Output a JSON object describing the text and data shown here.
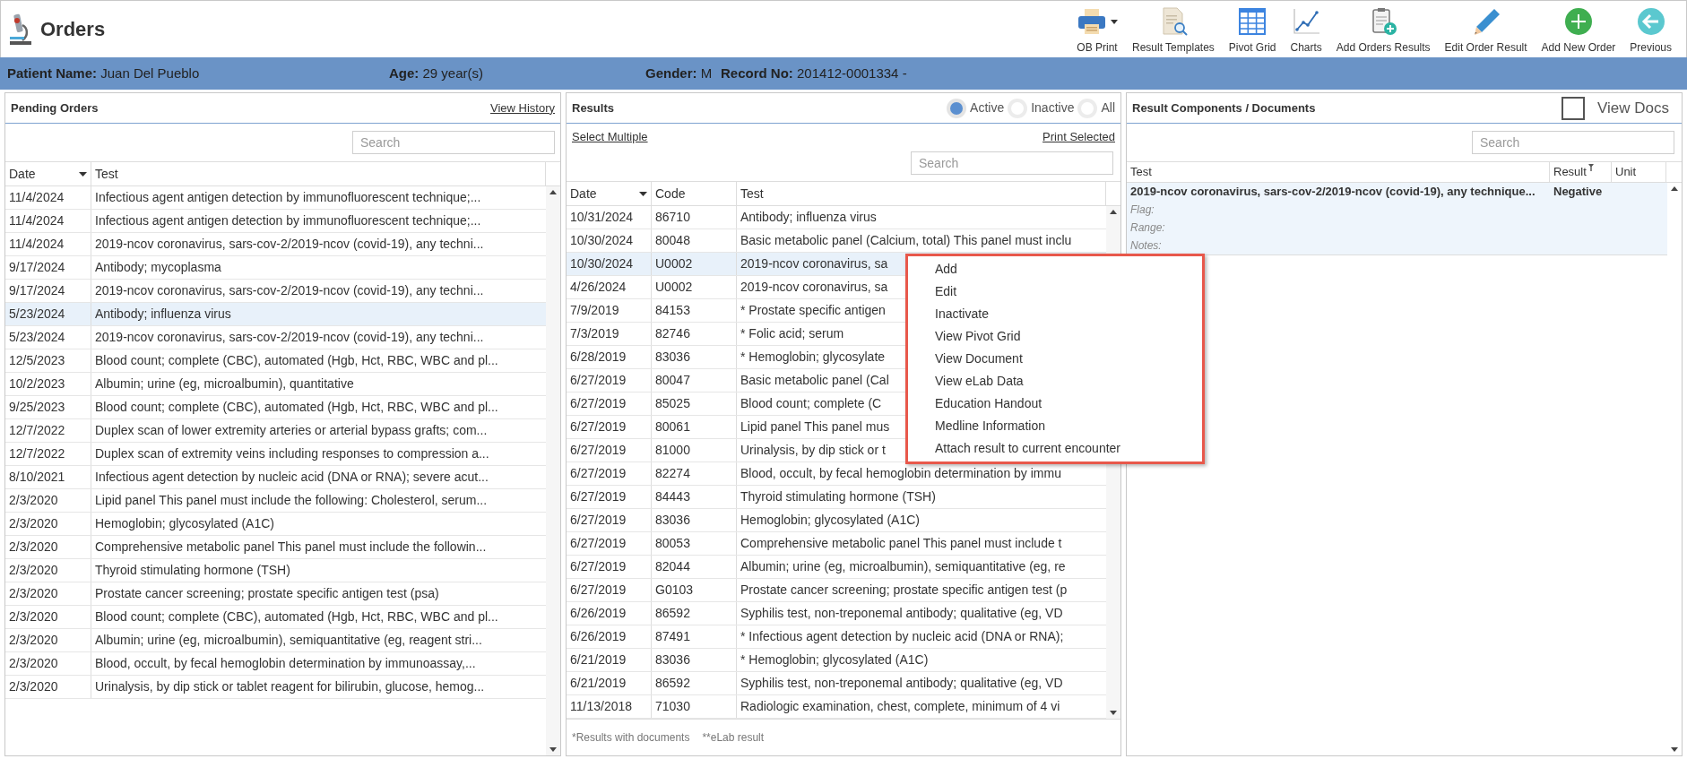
{
  "app": {
    "title": "Orders"
  },
  "toolbar": [
    {
      "label": "OB Print",
      "kind": "printer",
      "dropdown": true
    },
    {
      "label": "Result Templates",
      "kind": "templates",
      "dropdown": false
    },
    {
      "label": "Pivot Grid",
      "kind": "grid",
      "dropdown": false
    },
    {
      "label": "Charts",
      "kind": "chart",
      "dropdown": false
    },
    {
      "label": "Add Orders Results",
      "kind": "clipboard",
      "dropdown": false
    },
    {
      "label": "Edit Order Result",
      "kind": "pencil",
      "dropdown": false
    },
    {
      "label": "Add New Order",
      "kind": "add",
      "dropdown": false
    },
    {
      "label": "Previous",
      "kind": "back",
      "dropdown": false
    }
  ],
  "patient": [
    {
      "label": "Patient Name:",
      "value": "Juan Del Pueblo"
    },
    {
      "label": "Age:",
      "value": "29 year(s)"
    },
    {
      "label": "Gender:",
      "value": "M"
    },
    {
      "label": "Record No:",
      "value": "201412-0001334 -"
    }
  ],
  "pending_orders": {
    "title": "Pending Orders",
    "link": "View History",
    "search": {
      "placeholder": "Search"
    },
    "columns": [
      "Date",
      "Test"
    ],
    "rows": [
      {
        "date": "11/4/2024",
        "test": "Infectious agent antigen detection by immunofluorescent technique;...",
        "selected": false
      },
      {
        "date": "11/4/2024",
        "test": "Infectious agent antigen detection by immunofluorescent technique;...",
        "selected": false
      },
      {
        "date": "11/4/2024",
        "test": "2019-ncov coronavirus, sars-cov-2/2019-ncov (covid-19), any techni...",
        "selected": false
      },
      {
        "date": "9/17/2024",
        "test": "Antibody; mycoplasma",
        "selected": false
      },
      {
        "date": "9/17/2024",
        "test": "2019-ncov coronavirus, sars-cov-2/2019-ncov (covid-19), any techni...",
        "selected": false
      },
      {
        "date": "5/23/2024",
        "test": "Antibody; influenza virus",
        "selected": true
      },
      {
        "date": "5/23/2024",
        "test": "2019-ncov coronavirus, sars-cov-2/2019-ncov (covid-19), any techni...",
        "selected": false
      },
      {
        "date": "12/5/2023",
        "test": "Blood count; complete (CBC), automated (Hgb, Hct, RBC, WBC and pl...",
        "selected": false
      },
      {
        "date": "10/2/2023",
        "test": "Albumin; urine (eg, microalbumin), quantitative",
        "selected": false
      },
      {
        "date": "9/25/2023",
        "test": "Blood count; complete (CBC), automated (Hgb, Hct, RBC, WBC and pl...",
        "selected": false
      },
      {
        "date": "12/7/2022",
        "test": "Duplex scan of lower extremity arteries or arterial bypass grafts; com...",
        "selected": false
      },
      {
        "date": "12/7/2022",
        "test": "Duplex scan of extremity veins including responses to compression a...",
        "selected": false
      },
      {
        "date": "8/10/2021",
        "test": "Infectious agent detection by nucleic acid (DNA or RNA); severe acut...",
        "selected": false
      },
      {
        "date": "2/3/2020",
        "test": "Lipid panel This panel must include the following: Cholesterol, serum...",
        "selected": false
      },
      {
        "date": "2/3/2020",
        "test": "Hemoglobin; glycosylated (A1C)",
        "selected": false
      },
      {
        "date": "2/3/2020",
        "test": "Comprehensive metabolic panel This panel must include the followin...",
        "selected": false
      },
      {
        "date": "2/3/2020",
        "test": "Thyroid stimulating hormone (TSH)",
        "selected": false
      },
      {
        "date": "2/3/2020",
        "test": "Prostate cancer screening; prostate specific antigen test (psa)",
        "selected": false
      },
      {
        "date": "2/3/2020",
        "test": "Blood count; complete (CBC), automated (Hgb, Hct, RBC, WBC and pl...",
        "selected": false
      },
      {
        "date": "2/3/2020",
        "test": "Albumin; urine (eg, microalbumin), semiquantitative (eg, reagent stri...",
        "selected": false
      },
      {
        "date": "2/3/2020",
        "test": "Blood, occult, by fecal hemoglobin determination by immunoassay,...",
        "selected": false
      },
      {
        "date": "2/3/2020",
        "test": "Urinalysis, by dip stick or tablet reagent for bilirubin, glucose, hemog...",
        "selected": false
      }
    ]
  },
  "results": {
    "title": "Results",
    "filters": [
      {
        "label": "Active",
        "selected": true
      },
      {
        "label": "Inactive",
        "selected": false
      },
      {
        "label": "All",
        "selected": false
      }
    ],
    "links": [
      "Select Multiple",
      "Print Selected"
    ],
    "search": {
      "placeholder": "Search"
    },
    "columns": [
      "Date",
      "Code",
      "Test"
    ],
    "rows": [
      {
        "date": "10/31/2024",
        "code": "86710",
        "test": "Antibody; influenza virus",
        "selected": false
      },
      {
        "date": "10/30/2024",
        "code": "80048",
        "test": "Basic metabolic panel (Calcium, total) This panel must inclu",
        "selected": false
      },
      {
        "date": "10/30/2024",
        "code": "U0002",
        "test": "2019-ncov coronavirus, sa",
        "selected": true
      },
      {
        "date": "4/26/2024",
        "code": "U0002",
        "test": "2019-ncov coronavirus, sa",
        "selected": false
      },
      {
        "date": "7/9/2019",
        "code": "84153",
        "test": "* Prostate specific antigen",
        "selected": false
      },
      {
        "date": "7/3/2019",
        "code": "82746",
        "test": "* Folic acid; serum",
        "selected": false
      },
      {
        "date": "6/28/2019",
        "code": "83036",
        "test": "* Hemoglobin; glycosylate",
        "selected": false
      },
      {
        "date": "6/27/2019",
        "code": "80047",
        "test": "Basic metabolic panel (Cal",
        "selected": false
      },
      {
        "date": "6/27/2019",
        "code": "85025",
        "test": "Blood count; complete (C",
        "selected": false
      },
      {
        "date": "6/27/2019",
        "code": "80061",
        "test": "Lipid panel This panel mus",
        "selected": false
      },
      {
        "date": "6/27/2019",
        "code": "81000",
        "test": "Urinalysis, by dip stick or t",
        "selected": false
      },
      {
        "date": "6/27/2019",
        "code": "82274",
        "test": "Blood, occult, by fecal hemoglobin determination by immu",
        "selected": false
      },
      {
        "date": "6/27/2019",
        "code": "84443",
        "test": "Thyroid stimulating hormone (TSH)",
        "selected": false
      },
      {
        "date": "6/27/2019",
        "code": "83036",
        "test": "Hemoglobin; glycosylated (A1C)",
        "selected": false
      },
      {
        "date": "6/27/2019",
        "code": "80053",
        "test": "Comprehensive metabolic panel This panel must include t",
        "selected": false
      },
      {
        "date": "6/27/2019",
        "code": "82044",
        "test": "Albumin; urine (eg, microalbumin), semiquantitative (eg, re",
        "selected": false
      },
      {
        "date": "6/27/2019",
        "code": "G0103",
        "test": "Prostate cancer screening; prostate specific antigen test (p",
        "selected": false
      },
      {
        "date": "6/26/2019",
        "code": "86592",
        "test": "Syphilis test, non-treponemal antibody; qualitative (eg, VD",
        "selected": false
      },
      {
        "date": "6/26/2019",
        "code": "87491",
        "test": "* Infectious agent detection by nucleic acid (DNA or RNA);",
        "selected": false
      },
      {
        "date": "6/21/2019",
        "code": "83036",
        "test": "* Hemoglobin; glycosylated (A1C)",
        "selected": false
      },
      {
        "date": "6/21/2019",
        "code": "86592",
        "test": "Syphilis test, non-treponemal antibody; qualitative (eg, VD",
        "selected": false
      },
      {
        "date": "11/13/2018",
        "code": "71030",
        "test": "Radiologic examination, chest, complete, minimum of 4 vi",
        "selected": false
      }
    ],
    "footer": [
      "*Results with documents",
      "**eLab result"
    ]
  },
  "components": {
    "title": "Result Components / Documents",
    "view_docs": {
      "label": "View Docs",
      "checked": false
    },
    "search": {
      "placeholder": "Search"
    },
    "columns": [
      "Test",
      "Result",
      "Unit"
    ],
    "rows": [
      {
        "test": "2019-ncov coronavirus, sars-cov-2/2019-ncov (covid-19), any technique...",
        "result": "Negative",
        "selected": true,
        "details": [
          "Flag:",
          "Range:",
          "Notes:"
        ]
      }
    ]
  },
  "context_menu": {
    "items": [
      "Add",
      "Edit",
      "Inactivate",
      "View Pivot Grid",
      "View Document",
      "View eLab Data",
      "Education Handout",
      "Medline Information",
      "Attach result to current encounter"
    ]
  }
}
